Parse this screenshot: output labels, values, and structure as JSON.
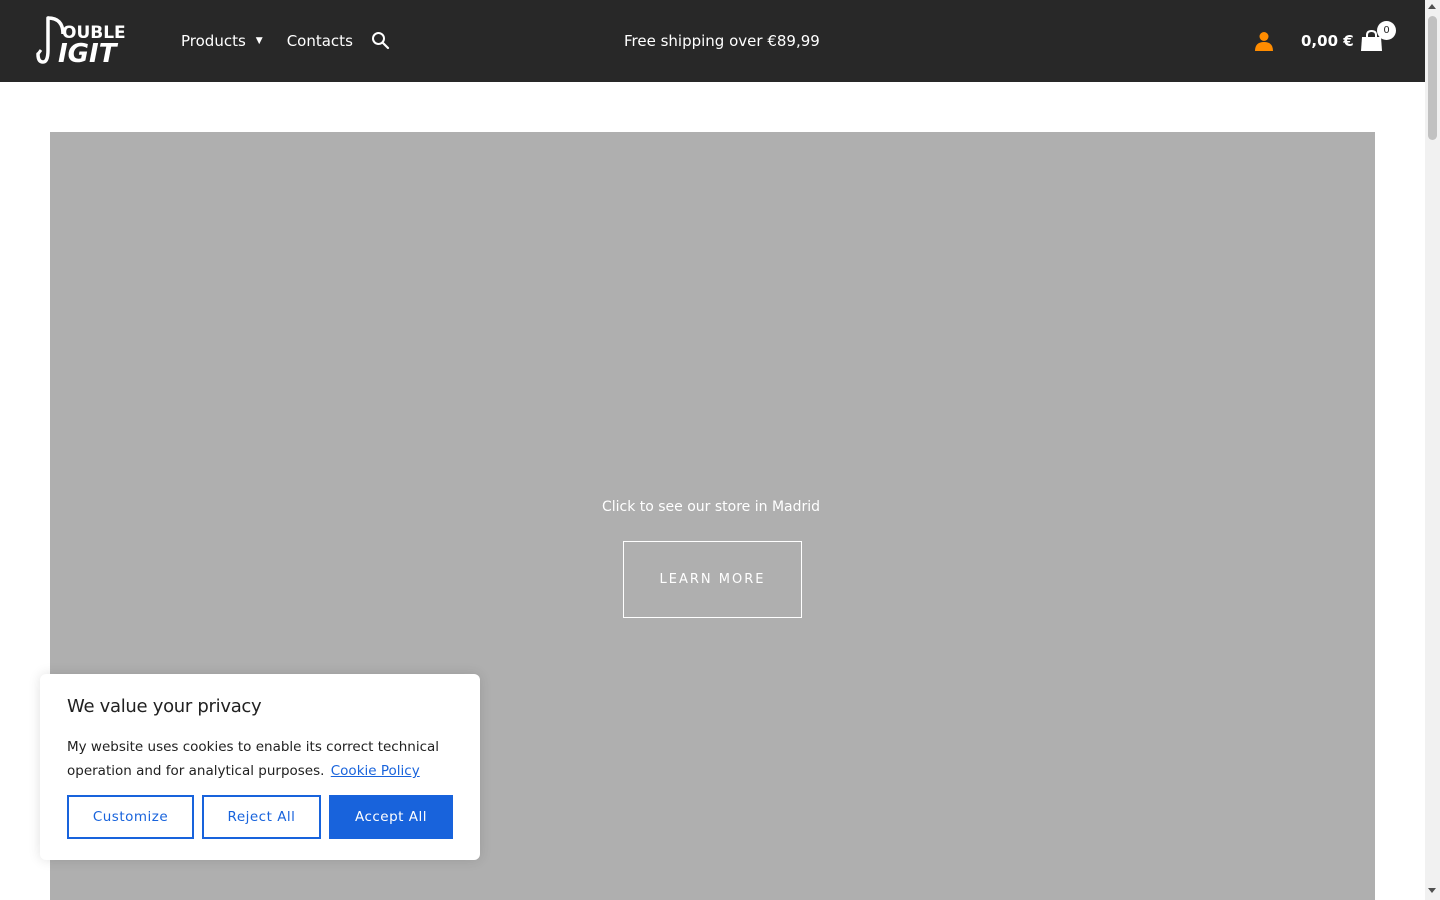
{
  "header": {
    "logo_text_top": "OUBLE",
    "logo_text_bottom": "IGIT",
    "nav": {
      "products_label": "Products",
      "contacts_label": "Contacts"
    },
    "promo_text": "Free shipping over €89,99",
    "cart_total": "0,00 €",
    "cart_count": "0"
  },
  "hero": {
    "text": "Click to see our store in  Madrid",
    "button_label": "LEARN  MORE"
  },
  "cookie": {
    "title": "We value your privacy",
    "body": "My website uses cookies to enable its correct technical operation and for analytical purposes.",
    "link_label": "Cookie Policy",
    "customize_label": "Customize",
    "reject_label": "Reject All",
    "accept_label": "Accept All"
  },
  "colors": {
    "header_bg": "#282828",
    "hero_bg": "#afafaf",
    "accent_blue": "#1863dc",
    "user_icon": "#ff8c00"
  },
  "icons": {
    "search": "search-icon",
    "user": "user-icon",
    "cart": "shopping-bag-icon"
  }
}
